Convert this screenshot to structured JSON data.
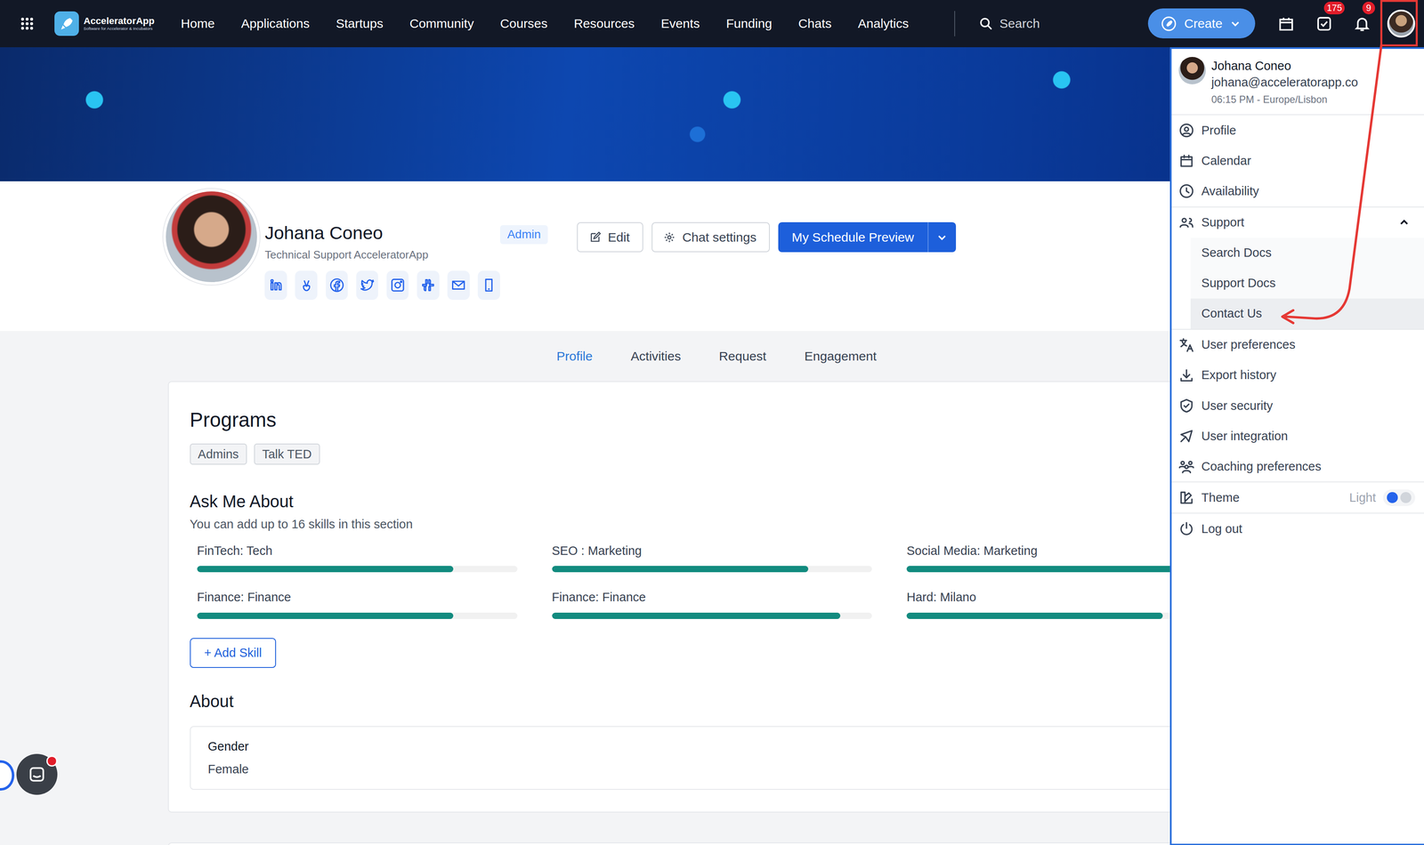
{
  "nav": {
    "logo": "AcceleratorApp",
    "logo_tagline": "Software for Accelerator & Incubators",
    "links": [
      "Home",
      "Applications",
      "Startups",
      "Community",
      "Courses",
      "Resources",
      "Events",
      "Funding",
      "Chats",
      "Analytics"
    ],
    "search_placeholder": "Search",
    "create_button": "Create",
    "tasks_badge": "175",
    "notifications_badge": "9"
  },
  "profile": {
    "name": "Johana Coneo",
    "title": "Technical Support AcceleratorApp",
    "role_badge": "Admin",
    "edit_button": "Edit",
    "chat_settings_button": "Chat settings",
    "schedule_button": "My Schedule Preview"
  },
  "tabs": [
    {
      "label": "Profile",
      "selected": true
    },
    {
      "label": "Activities",
      "selected": false
    },
    {
      "label": "Request",
      "selected": false
    },
    {
      "label": "Engagement",
      "selected": false
    }
  ],
  "programs": {
    "title": "Programs",
    "tags": [
      "Admins",
      "Talk TED"
    ]
  },
  "skills": {
    "title": "Ask Me About",
    "subtitle": "You can add up to 16 skills in this section",
    "items": [
      {
        "label": "FinTech: Tech",
        "level": 0.8
      },
      {
        "label": "SEO : Marketing",
        "level": 0.8
      },
      {
        "label": "Social Media: Marketing",
        "level": 0.85
      },
      {
        "label": "Finance: Finance",
        "level": 0.8
      },
      {
        "label": "Finance: Finance",
        "level": 0.9
      },
      {
        "label": "Hard: Milano",
        "level": 0.8
      }
    ],
    "add_button": "+ Add Skill"
  },
  "about": {
    "title": "About",
    "fields": [
      {
        "label": "Gender",
        "value": "Female"
      }
    ]
  },
  "user_menu": {
    "name": "Johana Coneo",
    "email": "johana@acceleratorapp.co",
    "local_time": "06:15 PM - Europe/Lisbon",
    "sections": [
      [
        {
          "label": "Profile",
          "kind": "item",
          "highlighted": false
        },
        {
          "label": "Calendar",
          "kind": "item",
          "highlighted": false
        },
        {
          "label": "Availability",
          "kind": "item",
          "highlighted": false
        }
      ],
      [
        {
          "label": "Support",
          "kind": "group",
          "expanded": true,
          "highlighted": false,
          "children": [
            {
              "label": "Search Docs",
              "highlighted": false
            },
            {
              "label": "Support Docs",
              "highlighted": false
            },
            {
              "label": "Contact Us",
              "highlighted": true
            }
          ]
        }
      ],
      [
        {
          "label": "User preferences",
          "kind": "item",
          "highlighted": false
        },
        {
          "label": "Export history",
          "kind": "item",
          "highlighted": false
        },
        {
          "label": "User security",
          "kind": "item",
          "highlighted": false
        },
        {
          "label": "User integration",
          "kind": "item",
          "highlighted": false
        },
        {
          "label": "Coaching preferences",
          "kind": "item",
          "highlighted": false
        }
      ],
      [
        {
          "label": "Theme",
          "kind": "toggle",
          "value": "Light",
          "dark_mode": false,
          "highlighted": false
        }
      ],
      [
        {
          "label": "Log out",
          "kind": "item",
          "highlighted": false
        }
      ]
    ]
  }
}
